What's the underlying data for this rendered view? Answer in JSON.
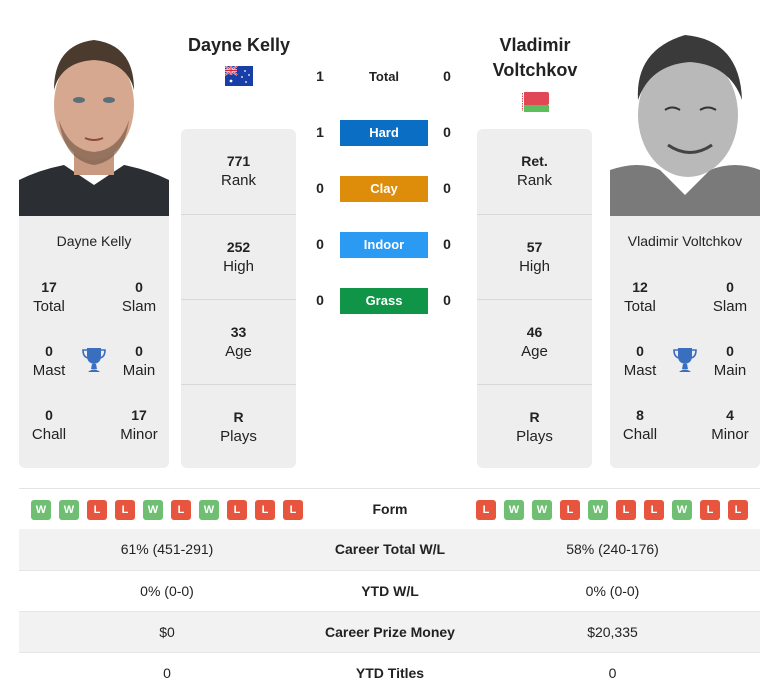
{
  "colors": {
    "hard": "#0a6ec4",
    "clay": "#de8d0a",
    "indoor": "#2a9af2",
    "grass": "#109447",
    "win": "#6fbf73",
    "loss": "#e8553e",
    "card_bg": "#eeeeee",
    "trophy": "#3a6fc0"
  },
  "players": {
    "left": {
      "name": "Dayne Kelly",
      "header_name": "Dayne Kelly",
      "flag": "australia-flag",
      "stats": [
        {
          "value": "771",
          "label": "Rank"
        },
        {
          "value": "252",
          "label": "High"
        },
        {
          "value": "33",
          "label": "Age"
        },
        {
          "value": "R",
          "label": "Plays"
        }
      ],
      "titles": {
        "total": {
          "value": "17",
          "label": "Total"
        },
        "slam": {
          "value": "0",
          "label": "Slam"
        },
        "mast": {
          "value": "0",
          "label": "Mast"
        },
        "main": {
          "value": "0",
          "label": "Main"
        },
        "chall": {
          "value": "0",
          "label": "Chall"
        },
        "minor": {
          "value": "17",
          "label": "Minor"
        }
      },
      "form": [
        "W",
        "W",
        "L",
        "L",
        "W",
        "L",
        "W",
        "L",
        "L",
        "L"
      ]
    },
    "right": {
      "name": "Vladimir Voltchkov",
      "header_name": "Vladimir Voltchkov",
      "flag": "belarus-flag",
      "stats": [
        {
          "value": "Ret.",
          "label": "Rank"
        },
        {
          "value": "57",
          "label": "High"
        },
        {
          "value": "46",
          "label": "Age"
        },
        {
          "value": "R",
          "label": "Plays"
        }
      ],
      "titles": {
        "total": {
          "value": "12",
          "label": "Total"
        },
        "slam": {
          "value": "0",
          "label": "Slam"
        },
        "mast": {
          "value": "0",
          "label": "Mast"
        },
        "main": {
          "value": "0",
          "label": "Main"
        },
        "chall": {
          "value": "8",
          "label": "Chall"
        },
        "minor": {
          "value": "4",
          "label": "Minor"
        }
      },
      "form": [
        "L",
        "W",
        "W",
        "L",
        "W",
        "L",
        "L",
        "W",
        "L",
        "L"
      ]
    }
  },
  "h2h": [
    {
      "surface": "Total",
      "left": "1",
      "right": "0"
    },
    {
      "surface": "Hard",
      "left": "1",
      "right": "0"
    },
    {
      "surface": "Clay",
      "left": "0",
      "right": "0"
    },
    {
      "surface": "Indoor",
      "left": "0",
      "right": "0"
    },
    {
      "surface": "Grass",
      "left": "0",
      "right": "0"
    }
  ],
  "form_label": "Form",
  "comparison": [
    {
      "label": "Career Total W/L",
      "left": "61% (451-291)",
      "right": "58% (240-176)"
    },
    {
      "label": "YTD W/L",
      "left": "0% (0-0)",
      "right": "0% (0-0)"
    },
    {
      "label": "Career Prize Money",
      "left": "$0",
      "right": "$20,335"
    },
    {
      "label": "YTD Titles",
      "left": "0",
      "right": "0"
    }
  ]
}
